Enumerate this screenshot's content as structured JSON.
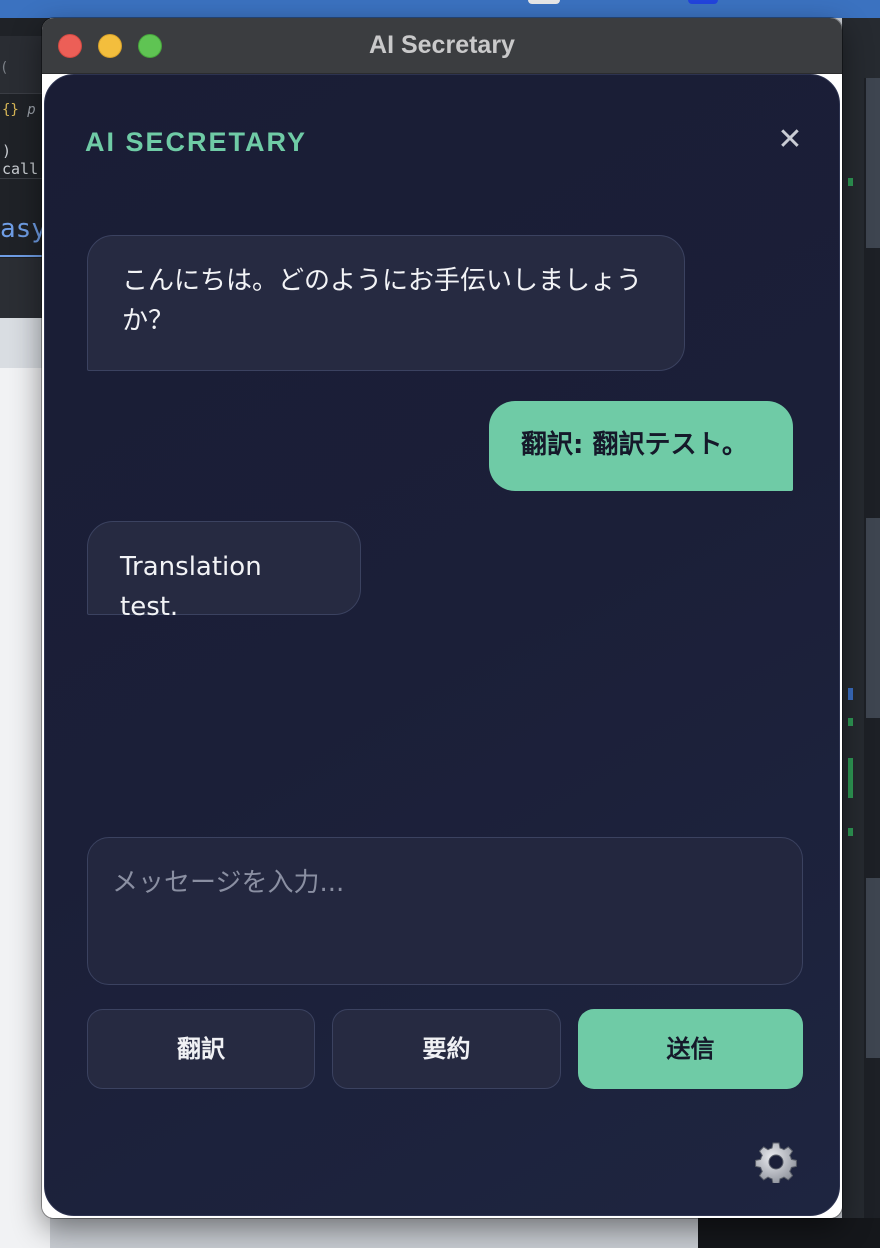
{
  "window": {
    "title": "AI Secretary"
  },
  "panel": {
    "heading": "AI SECRETARY",
    "close_glyph": "✕"
  },
  "messages": [
    {
      "role": "assistant",
      "text": "こんにちは。どのようにお手伝いしましょうか？"
    },
    {
      "role": "user",
      "text": "翻訳: 翻訳テスト。"
    },
    {
      "role": "assistant",
      "text": "Translation test."
    }
  ],
  "composer": {
    "placeholder": "メッセージを入力..."
  },
  "actions": {
    "translate_label": "翻訳",
    "summarize_label": "要約",
    "send_label": "送信"
  },
  "settings": {
    "icon": "gear-icon"
  },
  "colors": {
    "accent": "#6fcba6",
    "panel_background": "#1b1f38",
    "bubble_background": "#262a41"
  }
}
